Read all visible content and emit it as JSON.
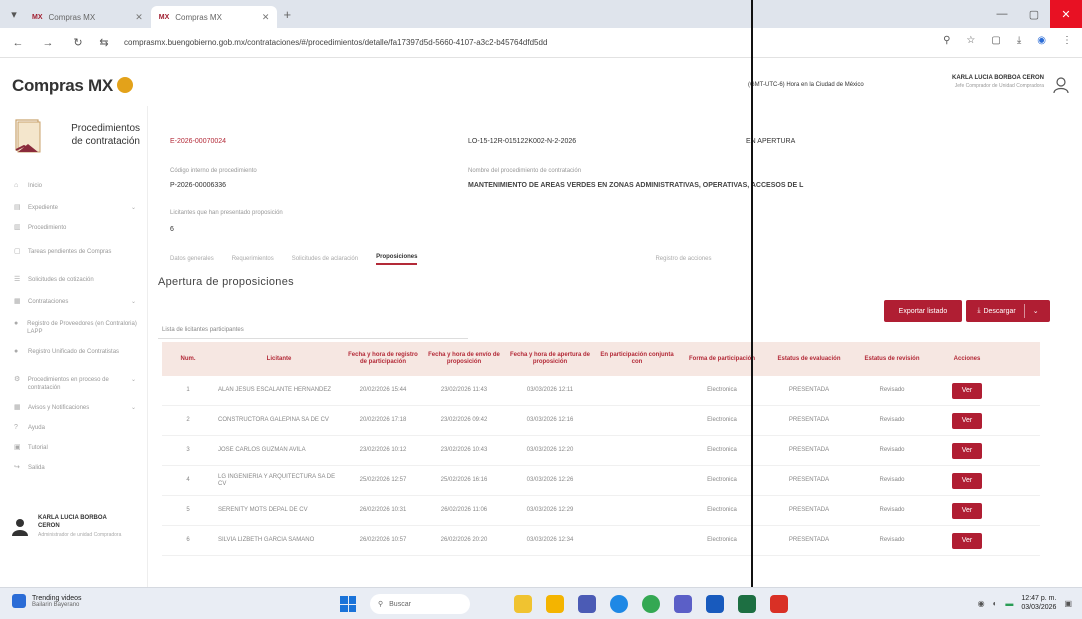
{
  "browser": {
    "tabs": [
      {
        "logo": "MX",
        "label": "Compras MX",
        "active": false
      },
      {
        "logo": "MX",
        "label": "Compras MX",
        "active": true
      }
    ],
    "new_tab": "+",
    "url": "comprasmx.buengobierno.gob.mx/contrataciones/#/procedimientos/detalle/fa17397d5d-5660-4107-a3c2-b45764dfd5dd",
    "url_prefix": "⇆"
  },
  "header": {
    "brand_text": "Compras MX",
    "timezone": "(GMT-UTC-6) Hora en la Ciudad de México",
    "user_name": "KARLA LUCIA BORBOA CERON",
    "user_role": "Jefe Comprador de Unidad Compradora"
  },
  "sidebar": {
    "title_line1": "Procedimientos",
    "title_line2": "de contratación",
    "items": [
      {
        "icon": "home-icon",
        "label": "Inicio",
        "chevron": false
      },
      {
        "icon": "expediente-icon",
        "label": "Expediente",
        "chevron": true
      },
      {
        "icon": "chart-icon",
        "label": "Procedimiento",
        "chevron": false
      },
      {
        "icon": "doc-icon",
        "label": "Tareas pendientes de Compras",
        "chevron": false
      },
      {
        "icon": "list-icon",
        "label": "Solicitudes de cotización",
        "chevron": false
      },
      {
        "icon": "contracts-icon",
        "label": "Contrataciones",
        "chevron": true
      },
      {
        "icon": "registry-icon",
        "label": "Registro de Proveedores (en Contraloria) LAPP",
        "chevron": false
      },
      {
        "icon": "registry-icon",
        "label": "Registro Unificado de Contratistas",
        "chevron": false
      },
      {
        "icon": "process-icon",
        "label": "Procedimientos en proceso de contratación",
        "chevron": true
      },
      {
        "icon": "grid-icon",
        "label": "Avisos y Notificaciones",
        "chevron": true
      },
      {
        "icon": "help-icon",
        "label": "Ayuda",
        "chevron": false
      },
      {
        "icon": "lock-icon",
        "label": "Tutorial",
        "chevron": false
      },
      {
        "icon": "logout-icon",
        "label": "Salida",
        "chevron": false
      }
    ],
    "user_name_line1": "KARLA LUCIA BORBOA",
    "user_name_line2": "CERON",
    "user_role": "Administrador de unidad Compradora"
  },
  "procedure": {
    "number": "E-2026-00070024",
    "code": "LO-15-12R-015122K002-N-2-2026",
    "status": "EN APERTURA",
    "internal_code_label": "Código interno de procedimiento",
    "internal_code": "P-2026-00006336",
    "name_label": "Nombre del procedimiento de contratación",
    "name": "MANTENIMIENTO DE AREAS VERDES EN ZONAS ADMINISTRATIVAS, OPERATIVAS, ACCESOS DE L",
    "bidders_label": "Licitantes que han presentado proposición",
    "bidders": "6"
  },
  "tabs": [
    "Datos generales",
    "Requerimientos",
    "Solicitudes de aclaración",
    "Proposiciones",
    "Registro de acciones"
  ],
  "active_tab_index": 3,
  "section_title": "Apertura de proposiciones",
  "buttons": {
    "export": "Exportar listado",
    "download": "Descargar",
    "download_icon": "⤓",
    "download_chevron": "⌵",
    "view": "Ver"
  },
  "list_label": "Lista de licitantes participantes",
  "table": {
    "headers": [
      "Num.",
      "Licitante",
      "Fecha y hora de registro de participación",
      "Fecha y hora de envío de proposición",
      "Fecha y hora de apertura de proposición",
      "En participación conjunta con",
      "Forma de participación",
      "Estatus de evaluación",
      "Estatus de revisión",
      "Acciones"
    ],
    "rows": [
      {
        "num": "1",
        "bidder": "ALAN JESUS ESCALANTE HERNANDEZ",
        "reg": "20/02/2026 15:44",
        "sent": "23/02/2026 11:43",
        "open": "03/03/2026 12:11",
        "joint": "",
        "form": "Electronica",
        "eval": "PRESENTADA",
        "review": "Revisado"
      },
      {
        "num": "2",
        "bidder": "CONSTRUCTORA GALEPINA SA DE CV",
        "reg": "20/02/2026 17:18",
        "sent": "23/02/2026 09:42",
        "open": "03/03/2026 12:16",
        "joint": "",
        "form": "Electronica",
        "eval": "PRESENTADA",
        "review": "Revisado"
      },
      {
        "num": "3",
        "bidder": "JOSE CARLOS GUZMAN AVILA",
        "reg": "23/02/2026 10:12",
        "sent": "23/02/2026 10:43",
        "open": "03/03/2026 12:20",
        "joint": "",
        "form": "Electronica",
        "eval": "PRESENTADA",
        "review": "Revisado"
      },
      {
        "num": "4",
        "bidder": "LG INGENIERIA Y ARQUITECTURA SA DE CV",
        "reg": "25/02/2026 12:57",
        "sent": "25/02/2026 16:16",
        "open": "03/03/2026 12:26",
        "joint": "",
        "form": "Electronica",
        "eval": "PRESENTADA",
        "review": "Revisado"
      },
      {
        "num": "5",
        "bidder": "SERENITY MOTS DEPAL DE CV",
        "reg": "26/02/2026 10:31",
        "sent": "26/02/2026 11:06",
        "open": "03/03/2026 12:29",
        "joint": "",
        "form": "Electronica",
        "eval": "PRESENTADA",
        "review": "Revisado"
      },
      {
        "num": "6",
        "bidder": "SILVIA LIZBETH GARCIA SAMANO",
        "reg": "26/02/2026 10:57",
        "sent": "26/02/2026 20:20",
        "open": "03/03/2026 12:34",
        "joint": "",
        "form": "Electronica",
        "eval": "PRESENTADA",
        "review": "Revisado"
      }
    ]
  },
  "taskbar": {
    "weather_title": "Trending videos",
    "weather_sub": "Bailarin Bayerano",
    "search_placeholder": "Buscar",
    "time": "12:47 p. m.",
    "date": "03/03/2026"
  }
}
